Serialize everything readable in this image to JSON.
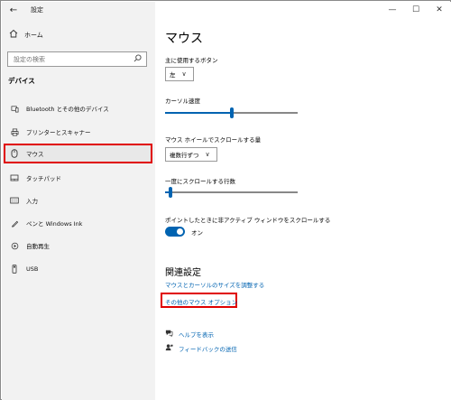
{
  "titlebar": {
    "back_icon": "back-arrow-icon",
    "title": "設定",
    "minimize": "—",
    "maximize": "☐",
    "close": "✕"
  },
  "sidebar": {
    "home_label": "ホーム",
    "search_placeholder": "設定の検索",
    "section_title": "デバイス",
    "items": [
      {
        "label": "Bluetooth とその他のデバイス",
        "icon": "bluetooth-icon",
        "selected": false
      },
      {
        "label": "プリンターとスキャナー",
        "icon": "printer-icon",
        "selected": false
      },
      {
        "label": "マウス",
        "icon": "mouse-icon",
        "selected": true
      },
      {
        "label": "タッチパッド",
        "icon": "touchpad-icon",
        "selected": false
      },
      {
        "label": "入力",
        "icon": "keyboard-icon",
        "selected": false
      },
      {
        "label": "ペンと Windows Ink",
        "icon": "pen-icon",
        "selected": false
      },
      {
        "label": "自動再生",
        "icon": "autoplay-icon",
        "selected": false
      },
      {
        "label": "USB",
        "icon": "usb-icon",
        "selected": false
      }
    ]
  },
  "main": {
    "title": "マウス",
    "primary_button": {
      "label": "主に使用するボタン",
      "value": "左"
    },
    "cursor_speed": {
      "label": "カーソル速度",
      "level": 0.5
    },
    "wheel_scroll": {
      "label": "マウス ホイールでスクロールする量",
      "value": "複数行ずつ"
    },
    "lines_to_scroll": {
      "label": "一度にスクロールする行数",
      "level": 0.03
    },
    "inactive_scroll": {
      "label": "ポイントしたときに非アクティブ ウィンドウをスクロールする",
      "state": "オン"
    },
    "related_title": "関連設定",
    "related_link_1": "マウスとカーソルのサイズを調整する",
    "related_link_2": "その他のマウス オプション",
    "help": "ヘルプを表示",
    "feedback": "フィードバックの送信"
  },
  "colors": {
    "accent": "#0063b1",
    "highlight": "#e00000",
    "sidebar_bg": "#f2f2f2"
  }
}
